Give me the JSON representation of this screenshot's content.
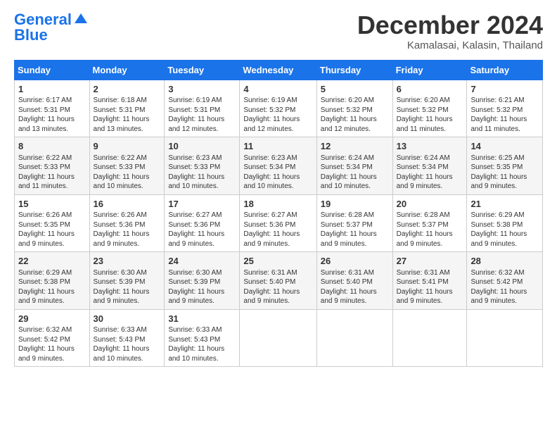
{
  "logo": {
    "line1": "General",
    "line2": "Blue"
  },
  "title": "December 2024",
  "subtitle": "Kamalasai, Kalasin, Thailand",
  "headers": [
    "Sunday",
    "Monday",
    "Tuesday",
    "Wednesday",
    "Thursday",
    "Friday",
    "Saturday"
  ],
  "weeks": [
    [
      {
        "day": "1",
        "info": "Sunrise: 6:17 AM\nSunset: 5:31 PM\nDaylight: 11 hours\nand 13 minutes."
      },
      {
        "day": "2",
        "info": "Sunrise: 6:18 AM\nSunset: 5:31 PM\nDaylight: 11 hours\nand 13 minutes."
      },
      {
        "day": "3",
        "info": "Sunrise: 6:19 AM\nSunset: 5:31 PM\nDaylight: 11 hours\nand 12 minutes."
      },
      {
        "day": "4",
        "info": "Sunrise: 6:19 AM\nSunset: 5:32 PM\nDaylight: 11 hours\nand 12 minutes."
      },
      {
        "day": "5",
        "info": "Sunrise: 6:20 AM\nSunset: 5:32 PM\nDaylight: 11 hours\nand 12 minutes."
      },
      {
        "day": "6",
        "info": "Sunrise: 6:20 AM\nSunset: 5:32 PM\nDaylight: 11 hours\nand 11 minutes."
      },
      {
        "day": "7",
        "info": "Sunrise: 6:21 AM\nSunset: 5:32 PM\nDaylight: 11 hours\nand 11 minutes."
      }
    ],
    [
      {
        "day": "8",
        "info": "Sunrise: 6:22 AM\nSunset: 5:33 PM\nDaylight: 11 hours\nand 11 minutes."
      },
      {
        "day": "9",
        "info": "Sunrise: 6:22 AM\nSunset: 5:33 PM\nDaylight: 11 hours\nand 10 minutes."
      },
      {
        "day": "10",
        "info": "Sunrise: 6:23 AM\nSunset: 5:33 PM\nDaylight: 11 hours\nand 10 minutes."
      },
      {
        "day": "11",
        "info": "Sunrise: 6:23 AM\nSunset: 5:34 PM\nDaylight: 11 hours\nand 10 minutes."
      },
      {
        "day": "12",
        "info": "Sunrise: 6:24 AM\nSunset: 5:34 PM\nDaylight: 11 hours\nand 10 minutes."
      },
      {
        "day": "13",
        "info": "Sunrise: 6:24 AM\nSunset: 5:34 PM\nDaylight: 11 hours\nand 9 minutes."
      },
      {
        "day": "14",
        "info": "Sunrise: 6:25 AM\nSunset: 5:35 PM\nDaylight: 11 hours\nand 9 minutes."
      }
    ],
    [
      {
        "day": "15",
        "info": "Sunrise: 6:26 AM\nSunset: 5:35 PM\nDaylight: 11 hours\nand 9 minutes."
      },
      {
        "day": "16",
        "info": "Sunrise: 6:26 AM\nSunset: 5:36 PM\nDaylight: 11 hours\nand 9 minutes."
      },
      {
        "day": "17",
        "info": "Sunrise: 6:27 AM\nSunset: 5:36 PM\nDaylight: 11 hours\nand 9 minutes."
      },
      {
        "day": "18",
        "info": "Sunrise: 6:27 AM\nSunset: 5:36 PM\nDaylight: 11 hours\nand 9 minutes."
      },
      {
        "day": "19",
        "info": "Sunrise: 6:28 AM\nSunset: 5:37 PM\nDaylight: 11 hours\nand 9 minutes."
      },
      {
        "day": "20",
        "info": "Sunrise: 6:28 AM\nSunset: 5:37 PM\nDaylight: 11 hours\nand 9 minutes."
      },
      {
        "day": "21",
        "info": "Sunrise: 6:29 AM\nSunset: 5:38 PM\nDaylight: 11 hours\nand 9 minutes."
      }
    ],
    [
      {
        "day": "22",
        "info": "Sunrise: 6:29 AM\nSunset: 5:38 PM\nDaylight: 11 hours\nand 9 minutes."
      },
      {
        "day": "23",
        "info": "Sunrise: 6:30 AM\nSunset: 5:39 PM\nDaylight: 11 hours\nand 9 minutes."
      },
      {
        "day": "24",
        "info": "Sunrise: 6:30 AM\nSunset: 5:39 PM\nDaylight: 11 hours\nand 9 minutes."
      },
      {
        "day": "25",
        "info": "Sunrise: 6:31 AM\nSunset: 5:40 PM\nDaylight: 11 hours\nand 9 minutes."
      },
      {
        "day": "26",
        "info": "Sunrise: 6:31 AM\nSunset: 5:40 PM\nDaylight: 11 hours\nand 9 minutes."
      },
      {
        "day": "27",
        "info": "Sunrise: 6:31 AM\nSunset: 5:41 PM\nDaylight: 11 hours\nand 9 minutes."
      },
      {
        "day": "28",
        "info": "Sunrise: 6:32 AM\nSunset: 5:42 PM\nDaylight: 11 hours\nand 9 minutes."
      }
    ],
    [
      {
        "day": "29",
        "info": "Sunrise: 6:32 AM\nSunset: 5:42 PM\nDaylight: 11 hours\nand 9 minutes."
      },
      {
        "day": "30",
        "info": "Sunrise: 6:33 AM\nSunset: 5:43 PM\nDaylight: 11 hours\nand 10 minutes."
      },
      {
        "day": "31",
        "info": "Sunrise: 6:33 AM\nSunset: 5:43 PM\nDaylight: 11 hours\nand 10 minutes."
      },
      null,
      null,
      null,
      null
    ]
  ]
}
